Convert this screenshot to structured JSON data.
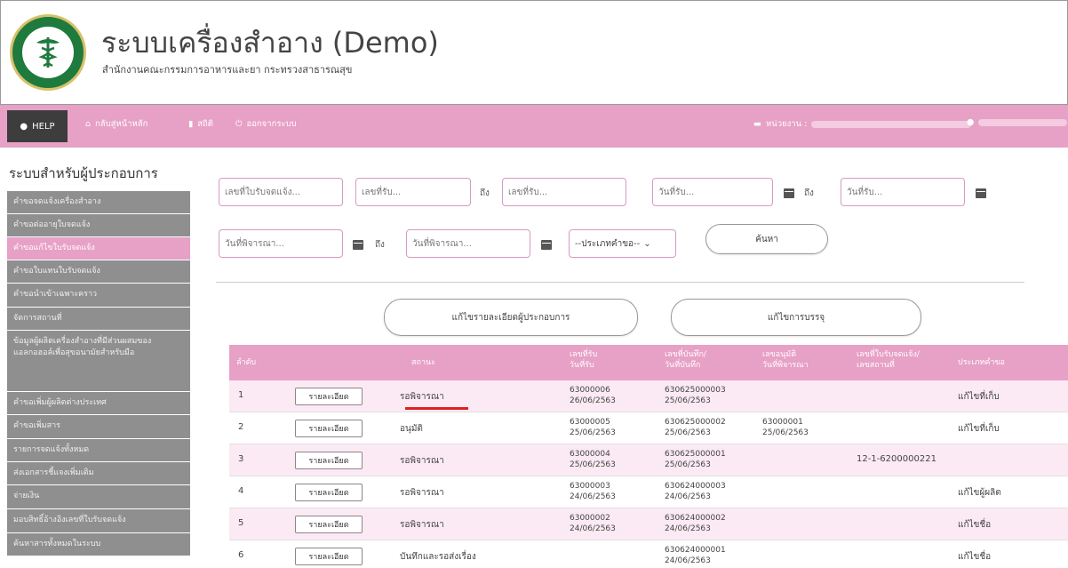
{
  "header": {
    "title": "ระบบเครื่องสำอาง (Demo)",
    "subtitle": "สำนักงานคณะกรรมการอาหารและยา กระทรวงสาธารณสุข"
  },
  "navbar": {
    "help": "HELP",
    "home": "กลับสู่หน้าหลัก",
    "stats": "สถิติ",
    "logout": "ออกจากระบบ",
    "agency_label": "หน่วยงาน :"
  },
  "sidebar": {
    "title": "ระบบสำหรับผู้ประกอบการ",
    "items": [
      "คำขอจดแจ้งเครื่องสำอาง",
      "คำขอต่ออายุใบจดแจ้ง",
      "คำขอแก้ไขใบรับจดแจ้ง",
      "คำขอใบแทนใบรับจดแจ้ง",
      "คำขอนำเข้าเฉพาะคราว",
      "จัดการสถานที่",
      "ข้อมูลผู้ผลิตเครื่องสำอางที่มีส่วนผสมของแอลกอฮอล์เพื่อสุขอนามัยสำหรับมือ",
      "คำขอเพิ่มผู้ผลิตต่างประเทศ",
      "คำขอเพิ่มสาร",
      "รายการจดแจ้งทั้งหมด",
      "ส่งเอกสารชี้แจงเพิ่มเติม",
      "จ่ายเงิน",
      "มอบสิทธิ์อ้างอิงเลขที่ใบรับจดแจ้ง",
      "ค้นหาสารทั้งหมดในระบบ"
    ]
  },
  "filters": {
    "notify_no_placeholder": "เลขที่ใบรับจดแจ้ง...",
    "receive_no_placeholder": "เลขที่รับ...",
    "to_label": "ถึง",
    "receive_date_placeholder": "วันที่รับ...",
    "consider_date_placeholder": "วันที่พิจารณา...",
    "request_type_value": "--ประเภทคำขอ--",
    "search_button": "ค้นหา"
  },
  "actions": {
    "edit_operator": "แก้ไขรายละเอียดผู้ประกอบการ",
    "edit_package": "แก้ไขการบรรจุ"
  },
  "table": {
    "headers": {
      "no": "ลำดับ",
      "status": "สถานะ",
      "receive": "เลขที่รับ\nวันที่รับ",
      "record": "เลขที่บันทึก/\nวันที่บันทึก",
      "approve": "เลขอนุมัติ\nวันที่พิจารณา",
      "notify": "เลขที่ใบรับจดแจ้ง/\nเลขสถานที่",
      "type": "ประเภทคำขอ"
    },
    "detail_label": "รายละเอียด",
    "rows": [
      {
        "no": "1",
        "status": "รอพิจารณา",
        "receive_no": "63000006",
        "receive_date": "26/06/2563",
        "record_no": "630625000003",
        "record_date": "25/06/2563",
        "approve_no": "",
        "approve_date": "",
        "notify_no": "",
        "type": "แก้ไขที่เก็บ"
      },
      {
        "no": "2",
        "status": "อนุมัติ",
        "receive_no": "63000005",
        "receive_date": "25/06/2563",
        "record_no": "630625000002",
        "record_date": "25/06/2563",
        "approve_no": "63000001",
        "approve_date": "25/06/2563",
        "notify_no": "",
        "type": "แก้ไขที่เก็บ"
      },
      {
        "no": "3",
        "status": "รอพิจารณา",
        "receive_no": "63000004",
        "receive_date": "25/06/2563",
        "record_no": "630625000001",
        "record_date": "25/06/2563",
        "approve_no": "",
        "approve_date": "",
        "notify_no": "12-1-6200000221",
        "type": ""
      },
      {
        "no": "4",
        "status": "รอพิจารณา",
        "receive_no": "63000003",
        "receive_date": "24/06/2563",
        "record_no": "630624000003",
        "record_date": "24/06/2563",
        "approve_no": "",
        "approve_date": "",
        "notify_no": "",
        "type": "แก้ไขผู้ผลิต"
      },
      {
        "no": "5",
        "status": "รอพิจารณา",
        "receive_no": "63000002",
        "receive_date": "24/06/2563",
        "record_no": "630624000002",
        "record_date": "24/06/2563",
        "approve_no": "",
        "approve_date": "",
        "notify_no": "",
        "type": "แก้ไขชื่อ"
      },
      {
        "no": "6",
        "status": "บันทึกและรอส่งเรื่อง",
        "receive_no": "",
        "receive_date": "",
        "record_no": "630624000001",
        "record_date": "24/06/2563",
        "approve_no": "",
        "approve_date": "",
        "notify_no": "",
        "type": "แก้ไขชื่อ"
      }
    ]
  },
  "colors": {
    "accent_pink": "#e7a0c6",
    "sidebar_gray": "#8f8f8f",
    "highlight_red": "#e02020"
  }
}
